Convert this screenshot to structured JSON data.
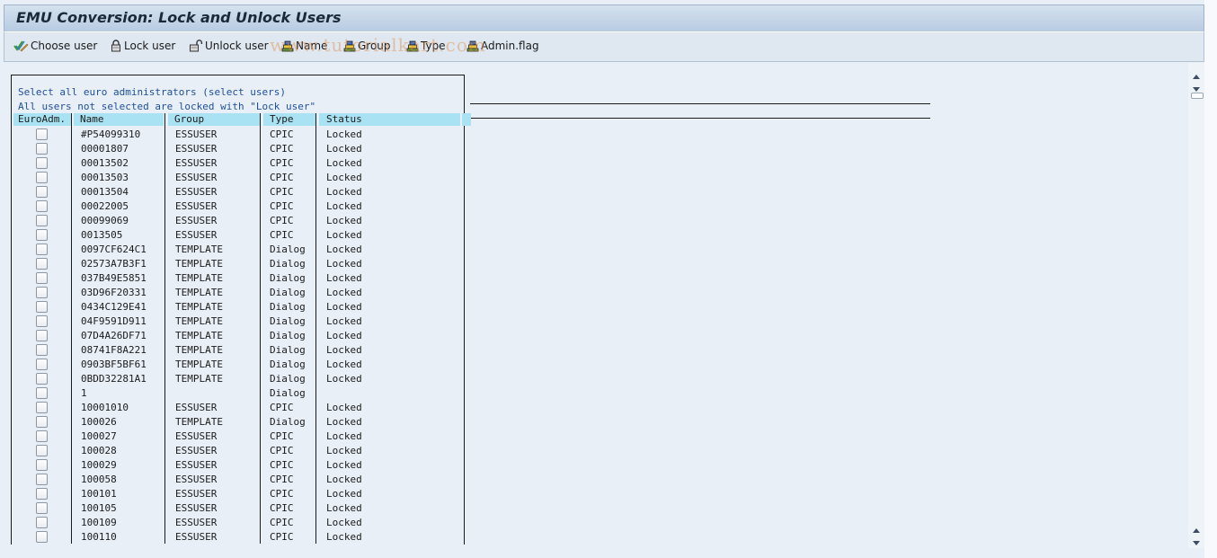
{
  "window": {
    "title": "EMU Conversion: Lock and Unlock Users"
  },
  "toolbar": {
    "buttons": [
      {
        "label": "Choose user",
        "icon": "choose-check-pencil-icon"
      },
      {
        "label": "Lock user",
        "icon": "lock-icon"
      },
      {
        "label": "Unlock user",
        "icon": "unlock-icon"
      },
      {
        "label": "Name",
        "icon": "sort-ascending-icon"
      },
      {
        "label": "Group",
        "icon": "sort-ascending-icon"
      },
      {
        "label": "Type",
        "icon": "sort-ascending-icon"
      },
      {
        "label": "Admin.flag",
        "icon": "sort-ascending-icon"
      }
    ]
  },
  "watermark": "www.tutorialkart.com",
  "info": {
    "line1": "Select all euro administrators (select users)",
    "line2": "All users not selected are locked with \"Lock user\""
  },
  "table": {
    "columns": [
      "EuroAdm.",
      "Name",
      "Group",
      "Type",
      "Status"
    ],
    "rows": [
      {
        "checked": false,
        "name": "#P54099310",
        "group": "ESSUSER",
        "type": "CPIC",
        "status": "Locked"
      },
      {
        "checked": false,
        "name": "00001807",
        "group": "ESSUSER",
        "type": "CPIC",
        "status": "Locked"
      },
      {
        "checked": false,
        "name": "00013502",
        "group": "ESSUSER",
        "type": "CPIC",
        "status": "Locked"
      },
      {
        "checked": false,
        "name": "00013503",
        "group": "ESSUSER",
        "type": "CPIC",
        "status": "Locked"
      },
      {
        "checked": false,
        "name": "00013504",
        "group": "ESSUSER",
        "type": "CPIC",
        "status": "Locked"
      },
      {
        "checked": false,
        "name": "00022005",
        "group": "ESSUSER",
        "type": "CPIC",
        "status": "Locked"
      },
      {
        "checked": false,
        "name": "00099069",
        "group": "ESSUSER",
        "type": "CPIC",
        "status": "Locked"
      },
      {
        "checked": false,
        "name": "0013505",
        "group": "ESSUSER",
        "type": "CPIC",
        "status": "Locked"
      },
      {
        "checked": false,
        "name": "0097CF624C1",
        "group": "TEMPLATE",
        "type": "Dialog",
        "status": "Locked"
      },
      {
        "checked": false,
        "name": "02573A7B3F1",
        "group": "TEMPLATE",
        "type": "Dialog",
        "status": "Locked"
      },
      {
        "checked": false,
        "name": "037B49E5851",
        "group": "TEMPLATE",
        "type": "Dialog",
        "status": "Locked"
      },
      {
        "checked": false,
        "name": "03D96F20331",
        "group": "TEMPLATE",
        "type": "Dialog",
        "status": "Locked"
      },
      {
        "checked": false,
        "name": "0434C129E41",
        "group": "TEMPLATE",
        "type": "Dialog",
        "status": "Locked"
      },
      {
        "checked": false,
        "name": "04F9591D911",
        "group": "TEMPLATE",
        "type": "Dialog",
        "status": "Locked"
      },
      {
        "checked": false,
        "name": "07D4A26DF71",
        "group": "TEMPLATE",
        "type": "Dialog",
        "status": "Locked"
      },
      {
        "checked": false,
        "name": "08741F8A221",
        "group": "TEMPLATE",
        "type": "Dialog",
        "status": "Locked"
      },
      {
        "checked": false,
        "name": "0903BF5BF61",
        "group": "TEMPLATE",
        "type": "Dialog",
        "status": "Locked"
      },
      {
        "checked": false,
        "name": "0BDD32281A1",
        "group": "TEMPLATE",
        "type": "Dialog",
        "status": "Locked"
      },
      {
        "checked": false,
        "name": "1",
        "group": "",
        "type": "Dialog",
        "status": ""
      },
      {
        "checked": false,
        "name": "10001010",
        "group": "ESSUSER",
        "type": "CPIC",
        "status": "Locked"
      },
      {
        "checked": false,
        "name": "100026",
        "group": "TEMPLATE",
        "type": "Dialog",
        "status": "Locked"
      },
      {
        "checked": false,
        "name": "100027",
        "group": "ESSUSER",
        "type": "CPIC",
        "status": "Locked"
      },
      {
        "checked": false,
        "name": "100028",
        "group": "ESSUSER",
        "type": "CPIC",
        "status": "Locked"
      },
      {
        "checked": false,
        "name": "100029",
        "group": "ESSUSER",
        "type": "CPIC",
        "status": "Locked"
      },
      {
        "checked": false,
        "name": "100058",
        "group": "ESSUSER",
        "type": "CPIC",
        "status": "Locked"
      },
      {
        "checked": false,
        "name": "100101",
        "group": "ESSUSER",
        "type": "CPIC",
        "status": "Locked"
      },
      {
        "checked": false,
        "name": "100105",
        "group": "ESSUSER",
        "type": "CPIC",
        "status": "Locked"
      },
      {
        "checked": false,
        "name": "100109",
        "group": "ESSUSER",
        "type": "CPIC",
        "status": "Locked"
      },
      {
        "checked": false,
        "name": "100110",
        "group": "ESSUSER",
        "type": "CPIC",
        "status": "Locked"
      }
    ]
  },
  "colors": {
    "header_bg": "#a9e2f2",
    "info_text": "#1f4f9a",
    "content_bg": "#e8eff7"
  }
}
